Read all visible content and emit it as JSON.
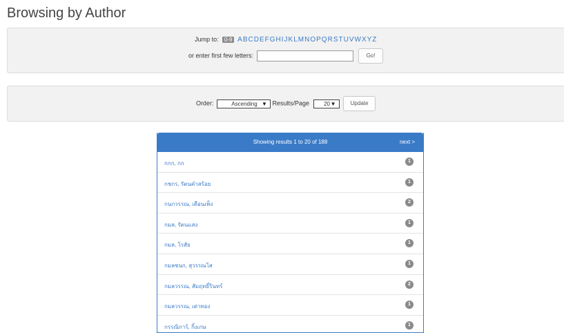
{
  "page": {
    "title": "Browsing by Author"
  },
  "jump": {
    "label": "Jump to:",
    "hash_label": "0-9",
    "letters": [
      "A",
      "B",
      "C",
      "D",
      "E",
      "F",
      "G",
      "H",
      "I",
      "J",
      "K",
      "L",
      "M",
      "N",
      "O",
      "P",
      "Q",
      "R",
      "S",
      "T",
      "U",
      "V",
      "W",
      "X",
      "Y",
      "Z"
    ],
    "enter_label": "or enter first few letters:",
    "input_value": "",
    "go_label": "Go!"
  },
  "order": {
    "order_label": "Order:",
    "order_value": "Ascending",
    "results_label": "Results/Page",
    "results_value": "20",
    "update_label": "Update"
  },
  "results": {
    "showing": "Showing results 1 to 20 of 188",
    "next": "next >",
    "items": [
      {
        "name": "กกก, กก",
        "count": "1"
      },
      {
        "name": "กชกร, รัตนคำสร้อย",
        "count": "1"
      },
      {
        "name": "กนกวรรณ, เดือนเพ็ง",
        "count": "2"
      },
      {
        "name": "กมล, รัตนแสง",
        "count": "1"
      },
      {
        "name": "กมล, โรสัย",
        "count": "1"
      },
      {
        "name": "กมลชนก, สุวรรณโส",
        "count": "1"
      },
      {
        "name": "กมลวรรณ, สัมฤทธิ์รินทร์",
        "count": "2"
      },
      {
        "name": "กมลวรรณ, เต่าทอง",
        "count": "1"
      },
      {
        "name": "กรรณิการ์, กิ้งเกษ",
        "count": "1"
      }
    ]
  },
  "colors": {
    "accent": "#3a7bc8",
    "link": "#3c7bc6",
    "panel": "#f2f2f2",
    "badge": "#8a8a8a"
  }
}
